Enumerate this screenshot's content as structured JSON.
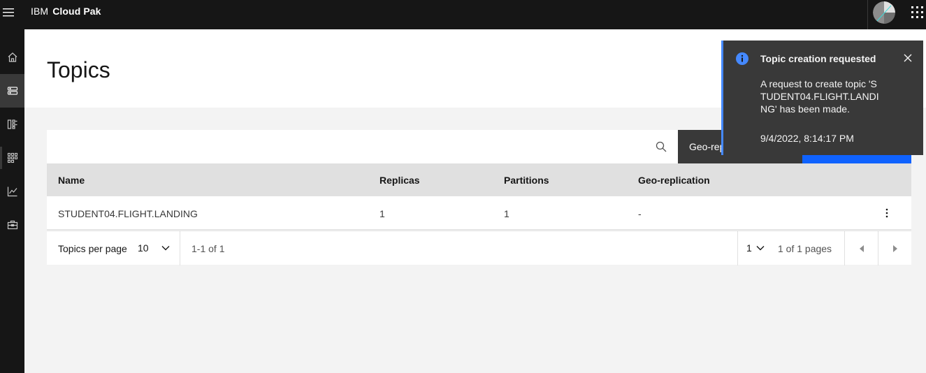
{
  "header": {
    "brand_prefix": "IBM",
    "brand_name": "Cloud Pak",
    "menu_icon": "hamburger-menu-icon",
    "avatar_icon": "user-avatar-icon",
    "switcher_icon": "app-switcher-grid-icon"
  },
  "sidenav": {
    "items": [
      {
        "icon": "home-icon",
        "active": false
      },
      {
        "icon": "topics-icon",
        "active": true
      },
      {
        "icon": "schema-icon",
        "active": false
      },
      {
        "icon": "consumer-groups-icon",
        "active": false
      },
      {
        "icon": "monitoring-chart-icon",
        "active": false
      },
      {
        "icon": "toolbox-icon",
        "active": false
      }
    ]
  },
  "page": {
    "title": "Topics"
  },
  "toolbar": {
    "search_value": "",
    "search_icon": "search-icon",
    "geo_button_label": "Geo-replication",
    "create_button_label": ""
  },
  "table": {
    "headers": [
      "Name",
      "Replicas",
      "Partitions",
      "Geo-replication"
    ],
    "rows": [
      {
        "name": "STUDENT04.FLIGHT.LANDING",
        "replicas": "1",
        "partitions": "1",
        "geo": "-"
      }
    ]
  },
  "pagination": {
    "per_page_label": "Topics per page",
    "per_page_value": "10",
    "range_text": "1-1 of 1",
    "page_value": "1",
    "pages_text": "1 of 1 pages"
  },
  "toast": {
    "title": "Topic creation requested",
    "subtitle": "A request to create topic 'STUDENT04.FLIGHT.LANDING' has been made.",
    "caption": "9/4/2022, 8:14:17 PM",
    "accent_color": "#4589ff",
    "icon": "info-icon",
    "close_icon": "close-icon"
  },
  "colors": {
    "shell_bg": "#161616",
    "page_bg": "#f3f3f3",
    "primary": "#0f62fe",
    "toast_bg": "#393939"
  }
}
